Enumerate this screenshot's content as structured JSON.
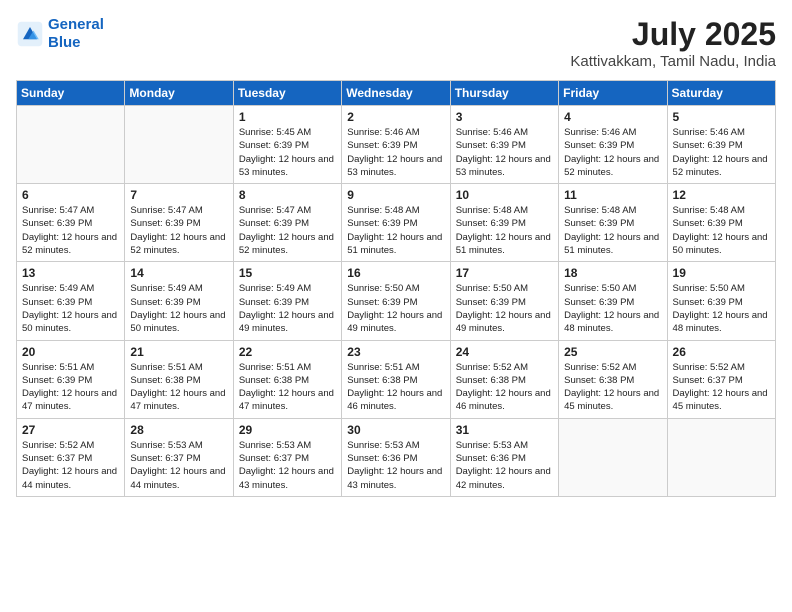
{
  "logo": {
    "line1": "General",
    "line2": "Blue"
  },
  "title": "July 2025",
  "subtitle": "Kattivakkam, Tamil Nadu, India",
  "days_header": [
    "Sunday",
    "Monday",
    "Tuesday",
    "Wednesday",
    "Thursday",
    "Friday",
    "Saturday"
  ],
  "weeks": [
    [
      {
        "day": "",
        "sunrise": "",
        "sunset": "",
        "daylight": ""
      },
      {
        "day": "",
        "sunrise": "",
        "sunset": "",
        "daylight": ""
      },
      {
        "day": "1",
        "sunrise": "Sunrise: 5:45 AM",
        "sunset": "Sunset: 6:39 PM",
        "daylight": "Daylight: 12 hours and 53 minutes."
      },
      {
        "day": "2",
        "sunrise": "Sunrise: 5:46 AM",
        "sunset": "Sunset: 6:39 PM",
        "daylight": "Daylight: 12 hours and 53 minutes."
      },
      {
        "day": "3",
        "sunrise": "Sunrise: 5:46 AM",
        "sunset": "Sunset: 6:39 PM",
        "daylight": "Daylight: 12 hours and 53 minutes."
      },
      {
        "day": "4",
        "sunrise": "Sunrise: 5:46 AM",
        "sunset": "Sunset: 6:39 PM",
        "daylight": "Daylight: 12 hours and 52 minutes."
      },
      {
        "day": "5",
        "sunrise": "Sunrise: 5:46 AM",
        "sunset": "Sunset: 6:39 PM",
        "daylight": "Daylight: 12 hours and 52 minutes."
      }
    ],
    [
      {
        "day": "6",
        "sunrise": "Sunrise: 5:47 AM",
        "sunset": "Sunset: 6:39 PM",
        "daylight": "Daylight: 12 hours and 52 minutes."
      },
      {
        "day": "7",
        "sunrise": "Sunrise: 5:47 AM",
        "sunset": "Sunset: 6:39 PM",
        "daylight": "Daylight: 12 hours and 52 minutes."
      },
      {
        "day": "8",
        "sunrise": "Sunrise: 5:47 AM",
        "sunset": "Sunset: 6:39 PM",
        "daylight": "Daylight: 12 hours and 52 minutes."
      },
      {
        "day": "9",
        "sunrise": "Sunrise: 5:48 AM",
        "sunset": "Sunset: 6:39 PM",
        "daylight": "Daylight: 12 hours and 51 minutes."
      },
      {
        "day": "10",
        "sunrise": "Sunrise: 5:48 AM",
        "sunset": "Sunset: 6:39 PM",
        "daylight": "Daylight: 12 hours and 51 minutes."
      },
      {
        "day": "11",
        "sunrise": "Sunrise: 5:48 AM",
        "sunset": "Sunset: 6:39 PM",
        "daylight": "Daylight: 12 hours and 51 minutes."
      },
      {
        "day": "12",
        "sunrise": "Sunrise: 5:48 AM",
        "sunset": "Sunset: 6:39 PM",
        "daylight": "Daylight: 12 hours and 50 minutes."
      }
    ],
    [
      {
        "day": "13",
        "sunrise": "Sunrise: 5:49 AM",
        "sunset": "Sunset: 6:39 PM",
        "daylight": "Daylight: 12 hours and 50 minutes."
      },
      {
        "day": "14",
        "sunrise": "Sunrise: 5:49 AM",
        "sunset": "Sunset: 6:39 PM",
        "daylight": "Daylight: 12 hours and 50 minutes."
      },
      {
        "day": "15",
        "sunrise": "Sunrise: 5:49 AM",
        "sunset": "Sunset: 6:39 PM",
        "daylight": "Daylight: 12 hours and 49 minutes."
      },
      {
        "day": "16",
        "sunrise": "Sunrise: 5:50 AM",
        "sunset": "Sunset: 6:39 PM",
        "daylight": "Daylight: 12 hours and 49 minutes."
      },
      {
        "day": "17",
        "sunrise": "Sunrise: 5:50 AM",
        "sunset": "Sunset: 6:39 PM",
        "daylight": "Daylight: 12 hours and 49 minutes."
      },
      {
        "day": "18",
        "sunrise": "Sunrise: 5:50 AM",
        "sunset": "Sunset: 6:39 PM",
        "daylight": "Daylight: 12 hours and 48 minutes."
      },
      {
        "day": "19",
        "sunrise": "Sunrise: 5:50 AM",
        "sunset": "Sunset: 6:39 PM",
        "daylight": "Daylight: 12 hours and 48 minutes."
      }
    ],
    [
      {
        "day": "20",
        "sunrise": "Sunrise: 5:51 AM",
        "sunset": "Sunset: 6:39 PM",
        "daylight": "Daylight: 12 hours and 47 minutes."
      },
      {
        "day": "21",
        "sunrise": "Sunrise: 5:51 AM",
        "sunset": "Sunset: 6:38 PM",
        "daylight": "Daylight: 12 hours and 47 minutes."
      },
      {
        "day": "22",
        "sunrise": "Sunrise: 5:51 AM",
        "sunset": "Sunset: 6:38 PM",
        "daylight": "Daylight: 12 hours and 47 minutes."
      },
      {
        "day": "23",
        "sunrise": "Sunrise: 5:51 AM",
        "sunset": "Sunset: 6:38 PM",
        "daylight": "Daylight: 12 hours and 46 minutes."
      },
      {
        "day": "24",
        "sunrise": "Sunrise: 5:52 AM",
        "sunset": "Sunset: 6:38 PM",
        "daylight": "Daylight: 12 hours and 46 minutes."
      },
      {
        "day": "25",
        "sunrise": "Sunrise: 5:52 AM",
        "sunset": "Sunset: 6:38 PM",
        "daylight": "Daylight: 12 hours and 45 minutes."
      },
      {
        "day": "26",
        "sunrise": "Sunrise: 5:52 AM",
        "sunset": "Sunset: 6:37 PM",
        "daylight": "Daylight: 12 hours and 45 minutes."
      }
    ],
    [
      {
        "day": "27",
        "sunrise": "Sunrise: 5:52 AM",
        "sunset": "Sunset: 6:37 PM",
        "daylight": "Daylight: 12 hours and 44 minutes."
      },
      {
        "day": "28",
        "sunrise": "Sunrise: 5:53 AM",
        "sunset": "Sunset: 6:37 PM",
        "daylight": "Daylight: 12 hours and 44 minutes."
      },
      {
        "day": "29",
        "sunrise": "Sunrise: 5:53 AM",
        "sunset": "Sunset: 6:37 PM",
        "daylight": "Daylight: 12 hours and 43 minutes."
      },
      {
        "day": "30",
        "sunrise": "Sunrise: 5:53 AM",
        "sunset": "Sunset: 6:36 PM",
        "daylight": "Daylight: 12 hours and 43 minutes."
      },
      {
        "day": "31",
        "sunrise": "Sunrise: 5:53 AM",
        "sunset": "Sunset: 6:36 PM",
        "daylight": "Daylight: 12 hours and 42 minutes."
      },
      {
        "day": "",
        "sunrise": "",
        "sunset": "",
        "daylight": ""
      },
      {
        "day": "",
        "sunrise": "",
        "sunset": "",
        "daylight": ""
      }
    ]
  ]
}
